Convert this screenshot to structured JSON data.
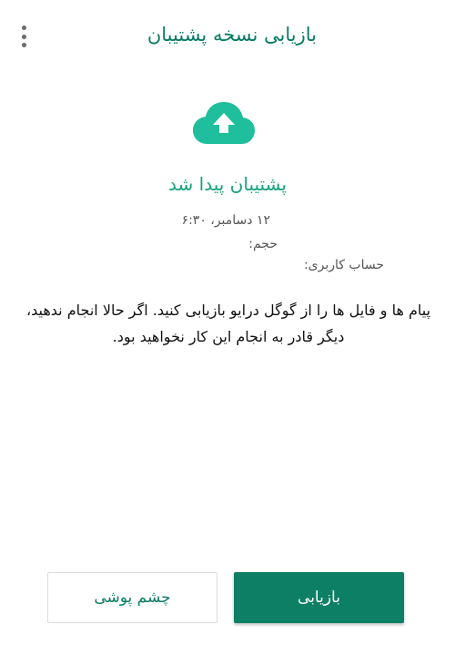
{
  "header": {
    "title": "بازیابی نسخه پشتیبان",
    "menu_icon": "more-vert-icon"
  },
  "backup": {
    "icon": "cloud-upload-icon",
    "status": "پشتیبان پیدا شد",
    "date": "۱۲ دسامبر، ۶:۳۰",
    "size_label": "حجم:",
    "account_label": "حساب کاربری:"
  },
  "description": "پیام ها و فایل ها را از گوگل درایو بازیابی کنید. اگر حالا انجام ندهید، دیگر قادر به انجام این کار نخواهید بود.",
  "actions": {
    "skip_label": "چشم پوشی",
    "restore_label": "بازیابی"
  },
  "colors": {
    "accent": "#0d7f65",
    "accent_light": "#1fbe9c",
    "title": "#0b7b63"
  }
}
